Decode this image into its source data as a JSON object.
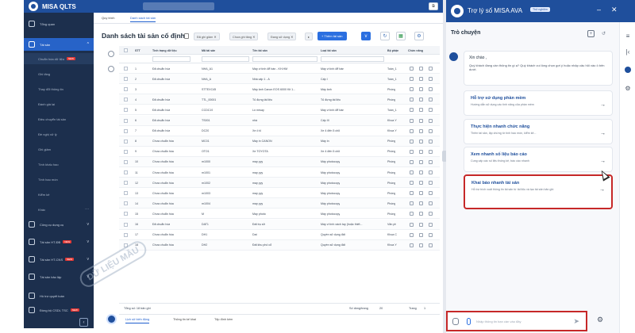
{
  "app": {
    "title": "MISA QLTS"
  },
  "tabs": [
    {
      "label": "Quy trình"
    },
    {
      "label": "Danh sách tài sản"
    }
  ],
  "sidebar": {
    "items": [
      {
        "label": "Tổng quan",
        "icon": "dashboard-icon"
      },
      {
        "label": "Tài sản",
        "icon": "building-icon",
        "active": true
      }
    ],
    "subitems": [
      {
        "label": "Chuẩn hóa dữ liệu",
        "new": "NEW"
      },
      {
        "label": "Ghi tăng"
      },
      {
        "label": "Thay đổi thông tin"
      },
      {
        "label": "Đánh giá lại"
      },
      {
        "label": "Điều chuyển tài sản"
      },
      {
        "label": "Đề nghị xử lý"
      },
      {
        "label": "Ghi giảm"
      },
      {
        "label": "Tính khấu hao"
      },
      {
        "label": "Tính hao mòn"
      },
      {
        "label": "Kiểm kê"
      },
      {
        "label": "Khác"
      }
    ],
    "groups": [
      {
        "label": "Công cụ dụng cụ"
      },
      {
        "label": "Tài sản HT-ĐB",
        "new": "NEW"
      },
      {
        "label": "Tài sản HT-CNS",
        "new": "NEW"
      },
      {
        "label": "Tài sản bảo lập"
      },
      {
        "label": "Hồ trợ quyết toán"
      },
      {
        "label": "Đồng bộ CSDL TSC",
        "new": "NEW"
      }
    ]
  },
  "main": {
    "title": "Danh sách tài sản cố định",
    "chips": [
      "Đã ghi giảm ✕",
      "Chưa ghi tăng ✕",
      "Đang sử dụng ✕"
    ],
    "add_button": "+ Thêm tài sản",
    "columns": [
      "STT",
      "Tình trạng dữ liệu",
      "Mã tài sản",
      "Tên tài sản",
      "Loại tài sản",
      "Bộ phận",
      "Chức năng"
    ],
    "rows": [
      [
        "1",
        "Đã chuẩn hóa",
        "NHA_A1",
        "Máy vi tính để bàn - KH.HM",
        "Máy vi tính để bàn",
        "Toàn_1"
      ],
      [
        "2",
        "Đã chuẩn hóa",
        "NHA_A",
        "Nhà cấp 1 - A",
        "Cấp I",
        "Toàn_1"
      ],
      [
        "3",
        "",
        "STTEXC45",
        "Máy ảnh Canon EOS 6000 Kit 1...",
        "Máy ảnh",
        "Phòng"
      ],
      [
        "4",
        "Đã chuẩn hóa",
        "TTL_00001",
        "Tủ đựng tài liệu",
        "Tủ đựng tài liệu",
        "Phòng"
      ],
      [
        "5",
        "Đã chuẩn hóa",
        "CCDC19",
        "Lò mrsay",
        "Máy vi tính để bàn",
        "Toàn_1"
      ],
      [
        "6",
        "Đã chuẩn hóa",
        "TS001",
        "nhà",
        "Cấp III",
        "Khoa Y"
      ],
      [
        "7",
        "Đã chuẩn hóa",
        "DC20",
        "Xe ô tô",
        "Xe 4 đến 5 chỗ",
        "Khoa Y"
      ],
      [
        "8",
        "Chưa chuẩn hóa",
        "MC01",
        "Máy in CANON",
        "Máy in",
        "Phòng"
      ],
      [
        "9",
        "Chưa chuẩn hóa",
        "OTO1",
        "Xe TOYOTA",
        "Xe 4 đến 5 chỗ",
        "Phòng"
      ],
      [
        "10",
        "Chưa chuẩn hóa",
        "m1000",
        "may yyy",
        "Máy photocopy",
        "Phòng"
      ],
      [
        "11",
        "Chưa chuẩn hóa",
        "m1001",
        "may yyy",
        "Máy photocopy",
        "Phòng"
      ],
      [
        "12",
        "Chưa chuẩn hóa",
        "m1002",
        "may yyy",
        "Máy photocopy",
        "Phòng"
      ],
      [
        "13",
        "Chưa chuẩn hóa",
        "m1003",
        "may yyy",
        "Máy photocopy",
        "Phòng"
      ],
      [
        "14",
        "Chưa chuẩn hóa",
        "m1004",
        "may yyy",
        "Máy photocopy",
        "Phòng"
      ],
      [
        "15",
        "Chưa chuẩn hóa",
        "M",
        "May photo",
        "Máy photocopy",
        "Phòng"
      ],
      [
        "16",
        "Đã chuẩn hóa",
        "DAT1",
        "Đất trụ sở",
        "Máy vi tính xách tay (hoặc thiết...",
        "Văn ph"
      ],
      [
        "17",
        "Chưa chuẩn hóa",
        "DH1",
        "Dat",
        "Quyền sử dụng đất",
        "Khoa C"
      ],
      [
        "18",
        "Chưa chuẩn hóa",
        "DH2",
        "Đất khu phố cổ",
        "Quyền sử dụng đất",
        "Khoa Y"
      ]
    ],
    "footer": {
      "total": "Tổng số: 18 bản ghi",
      "page_size_label": "Số dòng/trang",
      "page_size": "20",
      "page_label": "Trang",
      "page": "1"
    },
    "bottom_tabs": [
      "Lịch sử biến động",
      "Thông tin kế khai",
      "Tệp đính kèm"
    ],
    "watermark": "DỮ LIỆU MẪU"
  },
  "chat": {
    "title": "Trợ lý số MISA AVA",
    "beta": "Thử nghiệm",
    "conversation_title": "Trò chuyện",
    "greeting_title": "Xin chào ,",
    "greeting_body": "Quý khách đang cần thông tin gì ạ? Quý khách vui lòng chọn gợi ý hoặc nhập câu hỏi vào ô bên dưới.",
    "suggestions": [
      {
        "title": "Hỗ trợ sử dụng phần mềm",
        "desc": "Hướng dẫn sử dụng các tính năng của phần mềm"
      },
      {
        "title": "Thực hiện nhanh chức năng",
        "desc": "Thêm tài sản, lập chứng từ tính hao mòn, kiểm kê..."
      },
      {
        "title": "Xem nhanh số liệu báo cáo",
        "desc": "Cung cấp các số liệu thống kê, báo cáo nhanh"
      },
      {
        "title": "Khai báo nhanh tài sản",
        "desc": "Hỗ trợ trích xuất thông tin tài sản từ tài liệu và tạo tài sản bản ghi"
      }
    ],
    "input_placeholder": "Nhập thông tin bạn cần vào đây"
  }
}
